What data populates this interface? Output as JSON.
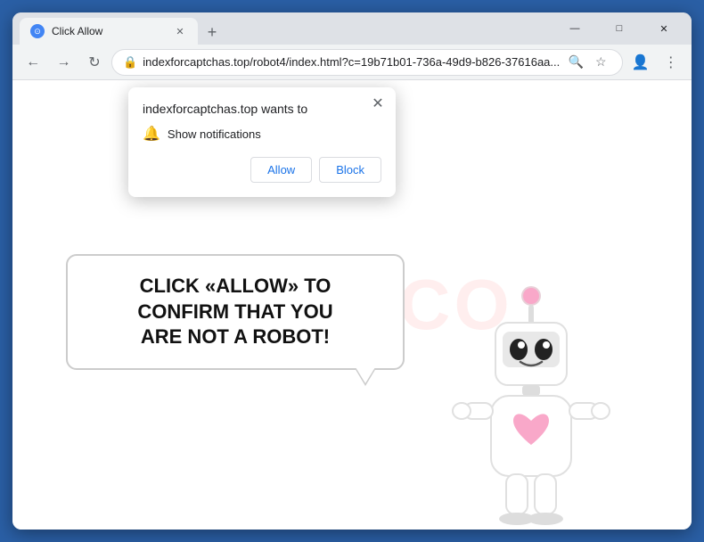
{
  "browser": {
    "tab": {
      "label": "Click Allow",
      "favicon": "⊙"
    },
    "new_tab_icon": "+",
    "window_controls": {
      "minimize": "—",
      "maximize": "□",
      "close": "✕"
    },
    "nav": {
      "back": "←",
      "forward": "→",
      "reload": "↻",
      "address": "indexforcaptchas.top/robot4/index.html?c=19b71b01-736a-49d9-b826-37616aa...",
      "search_icon": "🔍",
      "star_icon": "☆",
      "profile_icon": "👤",
      "menu_icon": "⋮"
    }
  },
  "notification_dialog": {
    "title": "indexforcaptchas.top wants to",
    "permission_text": "Show notifications",
    "close_icon": "✕",
    "allow_button": "Allow",
    "block_button": "Block"
  },
  "page": {
    "main_message_line1": "CLICK «ALLOW» TO CONFIRM THAT YOU",
    "main_message_line2": "ARE NOT A ROBOT!",
    "watermark": "RISK.CO"
  }
}
